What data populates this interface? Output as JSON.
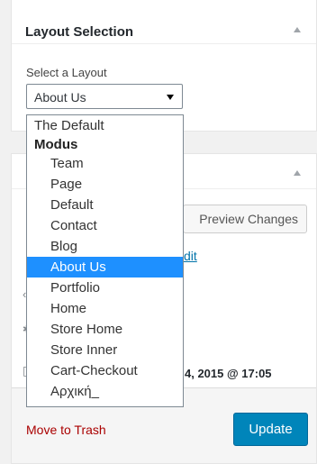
{
  "layout_box": {
    "title": "Layout Selection",
    "field_label": "Select a Layout",
    "selected_value": "About Us"
  },
  "dropdown": {
    "items": [
      {
        "label": "The Default",
        "type": "option"
      },
      {
        "label": "Modus",
        "type": "group"
      },
      {
        "label": "Team",
        "type": "option"
      },
      {
        "label": "Page",
        "type": "option"
      },
      {
        "label": "Default",
        "type": "option"
      },
      {
        "label": "Contact",
        "type": "option"
      },
      {
        "label": "Blog",
        "type": "option"
      },
      {
        "label": "About Us",
        "type": "option",
        "selected": true
      },
      {
        "label": "Portfolio",
        "type": "option"
      },
      {
        "label": "Home",
        "type": "option"
      },
      {
        "label": "Store Home",
        "type": "option"
      },
      {
        "label": "Store Inner",
        "type": "option"
      },
      {
        "label": "Cart-Checkout",
        "type": "option"
      },
      {
        "label": "Αρχική_",
        "type": "option"
      }
    ]
  },
  "publish_box": {
    "preview_label": "Preview Changes",
    "edit_link": "dit",
    "date_text": "4, 2015 @ 17:05"
  },
  "footer": {
    "trash_label": "Move to Trash",
    "update_label": "Update"
  },
  "colors": {
    "accent": "#0085ba",
    "link": "#0073aa",
    "danger": "#a00",
    "selected": "#1e90ff"
  }
}
